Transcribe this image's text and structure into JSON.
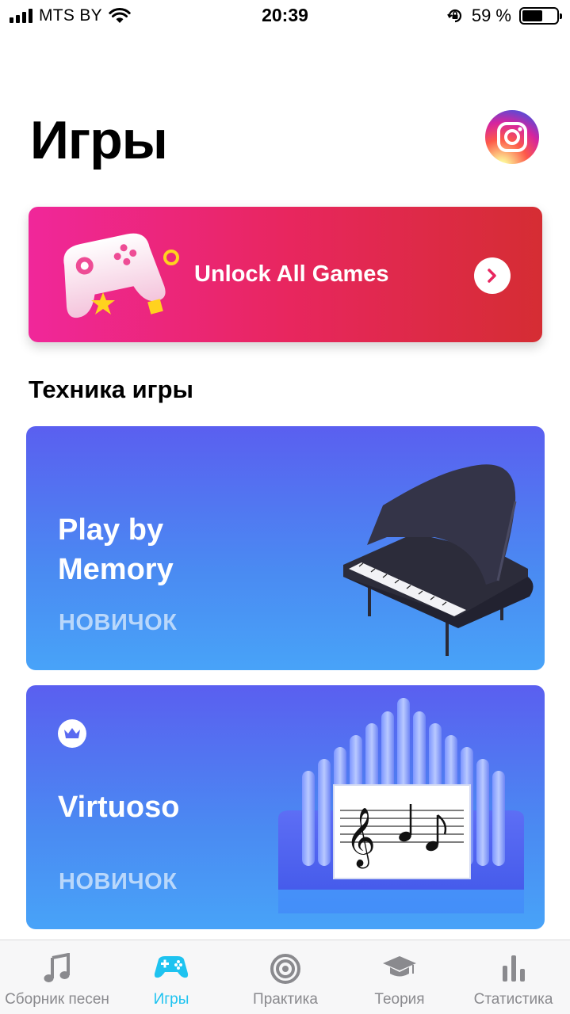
{
  "status_bar": {
    "carrier": "MTS BY",
    "time": "20:39",
    "battery_text": "59 %",
    "battery_level": 0.59
  },
  "header": {
    "title": "Игры",
    "instagram_icon": "instagram-icon"
  },
  "unlock_banner": {
    "label": "Unlock All Games",
    "colors": [
      "#f0279a",
      "#d52d33"
    ]
  },
  "section": {
    "title": "Техника игры"
  },
  "games": [
    {
      "title": "Play by Memory",
      "level": "НОВИЧОК",
      "icon": "grand-piano-icon",
      "premium": false
    },
    {
      "title": "Virtuoso",
      "level": "НОВИЧОК",
      "icon": "pipe-organ-icon",
      "premium": true
    }
  ],
  "tab_bar": {
    "accent_color": "#1ec3f0",
    "tabs": [
      {
        "label": "Сборник песен",
        "icon": "music-note-icon",
        "active": false
      },
      {
        "label": "Игры",
        "icon": "gamepad-icon",
        "active": true
      },
      {
        "label": "Практика",
        "icon": "target-icon",
        "active": false
      },
      {
        "label": "Теория",
        "icon": "graduation-cap-icon",
        "active": false
      },
      {
        "label": "Статистика",
        "icon": "bar-chart-icon",
        "active": false
      }
    ]
  }
}
